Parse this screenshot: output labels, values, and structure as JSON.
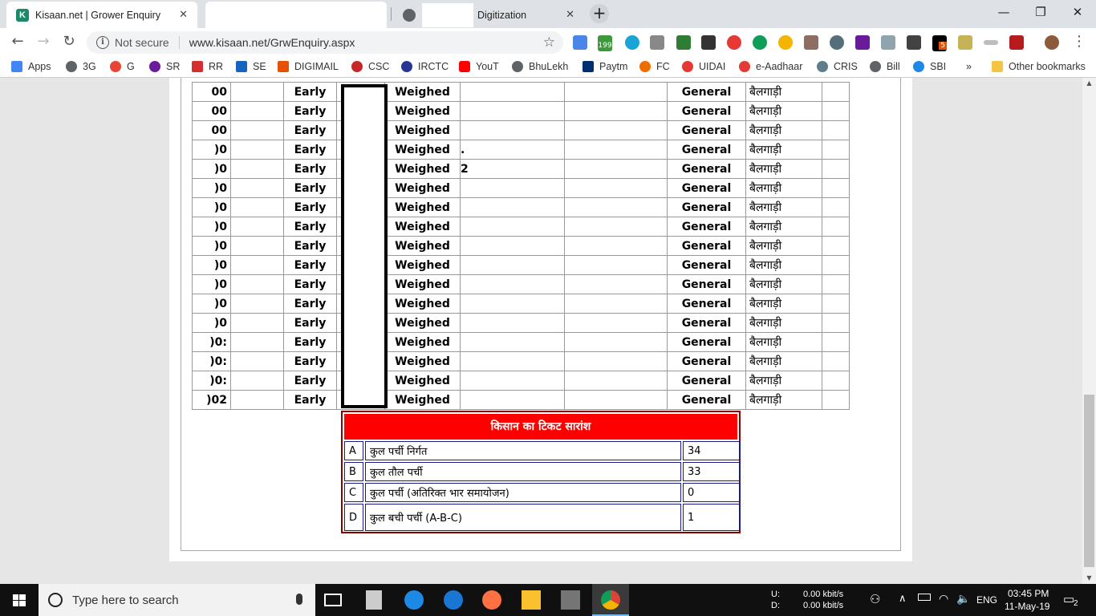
{
  "browser": {
    "tabs": [
      {
        "title": "Kisaan.net | Grower Enquiry",
        "favicon": "K",
        "active": true
      },
      {
        "title": "",
        "active": false
      },
      {
        "title": "Digitization",
        "active": false
      }
    ],
    "address": {
      "security_label": "Not secure",
      "url": "www.kisaan.net/GrwEnquiry.aspx"
    },
    "bookmarks": [
      "Apps",
      "3G",
      "G",
      "SR",
      "RR",
      "SE",
      "DIGIMAIL",
      "CSC",
      "IRCTC",
      "YouT",
      "BhuLekh",
      "Paytm",
      "FC",
      "UIDAI",
      "e-Aadhaar",
      "CRIS",
      "Bill",
      "SBI"
    ],
    "bookmarks_overflow": "»",
    "other_bookmarks": "Other bookmarks",
    "ext_badges": {
      "green": "199",
      "orange": "5"
    }
  },
  "grid": {
    "rows": [
      {
        "code": "00",
        "mode": "Early",
        "status": "Weighed",
        "c5": "",
        "cat": "General",
        "vehicle": "बैलगाड़ी"
      },
      {
        "code": "00",
        "mode": "Early",
        "status": "Weighed",
        "c5": "",
        "cat": "General",
        "vehicle": "बैलगाड़ी"
      },
      {
        "code": "00",
        "mode": "Early",
        "status": "Weighed",
        "c5": "",
        "cat": "General",
        "vehicle": "बैलगाड़ी"
      },
      {
        "code": ")0",
        "mode": "Early",
        "status": "Weighed",
        "c5": ".",
        "cat": "General",
        "vehicle": "बैलगाड़ी"
      },
      {
        "code": ")0",
        "mode": "Early",
        "status": "Weighed",
        "c5": "2",
        "cat": "General",
        "vehicle": "बैलगाड़ी"
      },
      {
        "code": ")0",
        "mode": "Early",
        "status": "Weighed",
        "c5": "",
        "cat": "General",
        "vehicle": "बैलगाड़ी"
      },
      {
        "code": ")0",
        "mode": "Early",
        "status": "Weighed",
        "c5": "",
        "cat": "General",
        "vehicle": "बैलगाड़ी"
      },
      {
        "code": ")0",
        "mode": "Early",
        "status": "Weighed",
        "c5": "",
        "cat": "General",
        "vehicle": "बैलगाड़ी"
      },
      {
        "code": ")0",
        "mode": "Early",
        "status": "Weighed",
        "c5": "",
        "cat": "General",
        "vehicle": "बैलगाड़ी"
      },
      {
        "code": ")0",
        "mode": "Early",
        "status": "Weighed",
        "c5": "",
        "cat": "General",
        "vehicle": "बैलगाड़ी"
      },
      {
        "code": ")0",
        "mode": "Early",
        "status": "Weighed",
        "c5": "",
        "cat": "General",
        "vehicle": "बैलगाड़ी"
      },
      {
        "code": ")0",
        "mode": "Early",
        "status": "Weighed",
        "c5": "",
        "cat": "General",
        "vehicle": "बैलगाड़ी"
      },
      {
        "code": ")0",
        "mode": "Early",
        "status": "Weighed",
        "c5": "",
        "cat": "General",
        "vehicle": "बैलगाड़ी"
      },
      {
        "code": ")0:",
        "mode": "Early",
        "status": "Weighed",
        "c5": "",
        "cat": "General",
        "vehicle": "बैलगाड़ी"
      },
      {
        "code": ")0:",
        "mode": "Early",
        "status": "Weighed",
        "c5": "",
        "cat": "General",
        "vehicle": "बैलगाड़ी"
      },
      {
        "code": ")0:",
        "mode": "Early",
        "status": "Weighed",
        "c5": "",
        "cat": "General",
        "vehicle": "बैलगाड़ी"
      },
      {
        "code": ")02",
        "mode": "Early",
        "status": "Weighed",
        "c5": "",
        "cat": "General",
        "vehicle": "बैलगाड़ी"
      }
    ]
  },
  "summary": {
    "title": "किसान का टिकट सारांश",
    "rows": [
      {
        "key": "A",
        "label": "कुल पर्ची निर्गत",
        "value": "34"
      },
      {
        "key": "B",
        "label": "कुल तौल पर्ची",
        "value": "33"
      },
      {
        "key": "C",
        "label": "कुल पर्ची (अतिरिक्त भार समायोजन)",
        "value": "0"
      },
      {
        "key": "D",
        "label": "कुल बची पर्ची (A-B-C)",
        "value": "1"
      }
    ]
  },
  "taskbar": {
    "search_placeholder": "Type here to search",
    "net_up_label": "U:",
    "net_down_label": "D:",
    "net_up": "0.00 kbit/s",
    "net_down": "0.00 kbit/s",
    "language": "ENG",
    "time": "03:45 PM",
    "date": "11-May-19",
    "notifications": "2"
  }
}
